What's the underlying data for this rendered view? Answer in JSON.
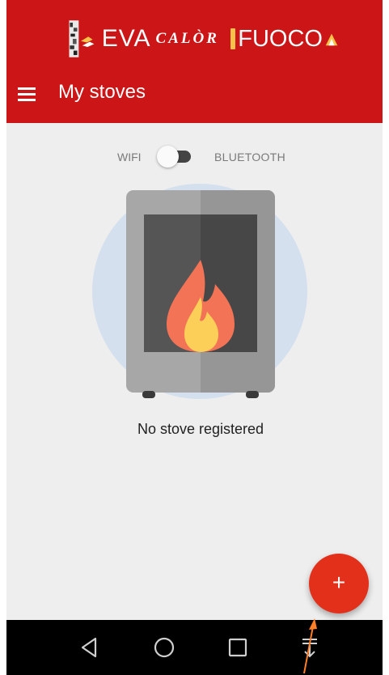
{
  "app": {
    "brand": {
      "eva": "EVA",
      "calor": "CALÒR",
      "fuoco": "FUOCO",
      "emblem_icon": "logo-emblem-icon",
      "flame_icon": "flame-logo-icon"
    },
    "title": "My stoves",
    "menu_icon": "hamburger-menu-icon",
    "accent_color": "#cc1517"
  },
  "connection_toggle": {
    "left_label": "WIFI",
    "right_label": "BLUETOOTH",
    "state": "wifi"
  },
  "empty_state": {
    "illustration": "stove-fire-illustration",
    "message": "No stove registered"
  },
  "fab": {
    "label": "+",
    "icon": "add-icon",
    "color": "#e3301b"
  },
  "system_nav": {
    "back_icon": "back-triangle-icon",
    "home_icon": "home-circle-icon",
    "recents_icon": "recents-square-icon",
    "notifications_icon": "pull-down-notifications-icon"
  }
}
